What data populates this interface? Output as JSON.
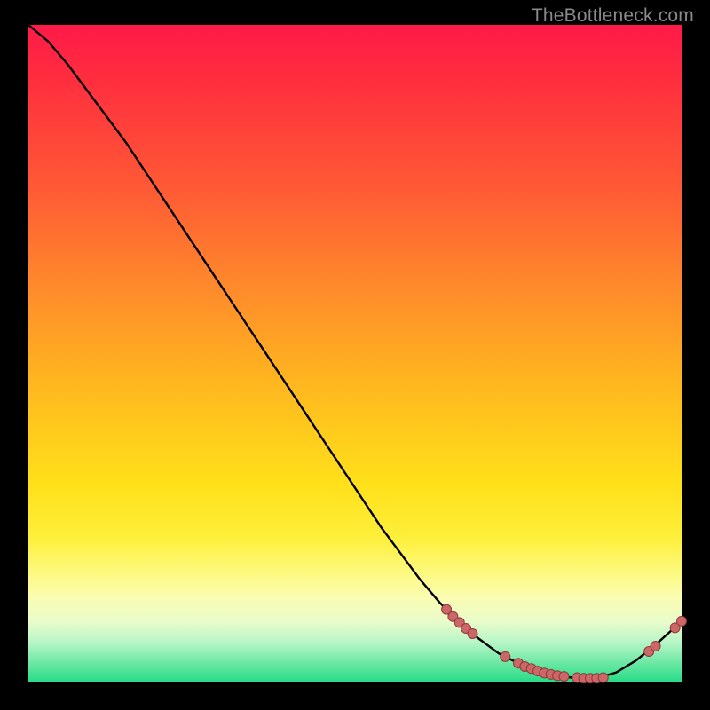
{
  "attribution": "TheBottleneck.com",
  "colors": {
    "curve": "#000000",
    "marker_fill": "#cd6667",
    "marker_stroke": "#8c3a3b"
  },
  "chart_data": {
    "type": "line",
    "title": "",
    "xlabel": "",
    "ylabel": "",
    "xlim": [
      0,
      100
    ],
    "ylim": [
      0,
      100
    ],
    "x": [
      0,
      3,
      6,
      9,
      12,
      15,
      18,
      21,
      24,
      27,
      30,
      33,
      36,
      39,
      42,
      45,
      48,
      51,
      54,
      57,
      60,
      63,
      66,
      69,
      72,
      75,
      78,
      81,
      84,
      87,
      90,
      93,
      96,
      100
    ],
    "y": [
      100,
      97.5,
      94,
      90,
      86,
      82,
      77.5,
      73,
      68.5,
      64,
      59.5,
      55,
      50.5,
      46,
      41.5,
      37,
      32.5,
      28,
      23.5,
      19.5,
      15.5,
      12,
      9,
      6.5,
      4.3,
      2.8,
      1.6,
      0.9,
      0.5,
      0.5,
      1.4,
      3.2,
      5.6,
      9.2
    ],
    "markers": [
      {
        "x": 64,
        "y": 11.0
      },
      {
        "x": 65,
        "y": 9.9
      },
      {
        "x": 66,
        "y": 9.0
      },
      {
        "x": 67,
        "y": 8.1
      },
      {
        "x": 68,
        "y": 7.3
      },
      {
        "x": 73,
        "y": 3.8
      },
      {
        "x": 75,
        "y": 2.8
      },
      {
        "x": 76,
        "y": 2.3
      },
      {
        "x": 77,
        "y": 2.0
      },
      {
        "x": 78,
        "y": 1.6
      },
      {
        "x": 79,
        "y": 1.3
      },
      {
        "x": 80,
        "y": 1.1
      },
      {
        "x": 81,
        "y": 0.9
      },
      {
        "x": 82,
        "y": 0.8
      },
      {
        "x": 84,
        "y": 0.6
      },
      {
        "x": 85,
        "y": 0.5
      },
      {
        "x": 86,
        "y": 0.5
      },
      {
        "x": 87,
        "y": 0.5
      },
      {
        "x": 88,
        "y": 0.6
      },
      {
        "x": 95,
        "y": 4.6
      },
      {
        "x": 96,
        "y": 5.4
      },
      {
        "x": 99,
        "y": 8.2
      },
      {
        "x": 100,
        "y": 9.2
      }
    ]
  }
}
